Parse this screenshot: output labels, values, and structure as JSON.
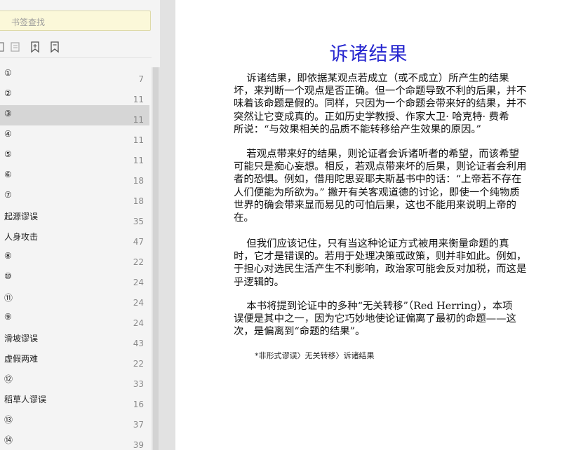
{
  "search": {
    "placeholder": "书签查找"
  },
  "toolbar": {
    "icons": [
      "bookmark-outline-icon",
      "expand-all-icon",
      "add-bookmark-icon",
      "bookmark-icon"
    ]
  },
  "bookmarks": [
    {
      "label": "①",
      "page": "7",
      "selected": false
    },
    {
      "label": "②",
      "page": "11",
      "selected": false
    },
    {
      "label": "③",
      "page": "11",
      "selected": true
    },
    {
      "label": "④",
      "page": "11",
      "selected": false
    },
    {
      "label": "⑤",
      "page": "11",
      "selected": false
    },
    {
      "label": "⑥",
      "page": "18",
      "selected": false
    },
    {
      "label": "⑦",
      "page": "18",
      "selected": false
    },
    {
      "label": "起源谬误",
      "page": "35",
      "selected": false
    },
    {
      "label": "人身攻击",
      "page": "47",
      "selected": false
    },
    {
      "label": "⑧",
      "page": "22",
      "selected": false
    },
    {
      "label": "⑩",
      "page": "24",
      "selected": false
    },
    {
      "label": "⑪",
      "page": "24",
      "selected": false
    },
    {
      "label": "⑨",
      "page": "24",
      "selected": false
    },
    {
      "label": "滑坡谬误",
      "page": "43",
      "selected": false
    },
    {
      "label": "虚假两难",
      "page": "22",
      "selected": false
    },
    {
      "label": "⑫",
      "page": "33",
      "selected": false
    },
    {
      "label": "稻草人谬误",
      "page": "16",
      "selected": false
    },
    {
      "label": "⑬",
      "page": "37",
      "selected": false
    },
    {
      "label": "⑭",
      "page": "39",
      "selected": false
    }
  ],
  "document": {
    "title": "诉诸结果",
    "paragraphs": [
      "    诉诸结果，即依据某观点若成立（或不成立）所产生的结果\n坏，来判断一个观点是否正确。但一个命题导致不利的后果，并不\n味着该命题是假的。同样，只因为一个命题会带来好的结果，并不\n突然让它变成真的。正如历史学教授、作家大卫· 哈克特· 费希\n所说：“与效果相关的品质不能转移给产生效果的原因。”",
      "    若观点带来好的结果，则论证者会诉诸听者的希望，而该希望\n可能只是痴心妄想。相反，若观点带来坏的后果，则论证者会利用\n者的恐惧。例如，借用陀思妥耶夫斯基书中的话：“上帝若不存在\n人们便能为所欲为。” 撇开有关客观道德的讨论，即使一个纯物质\n世界的确会带来显而易见的可怕后果，这也不能用来说明上帝的\n在。",
      "    但我们应该记住，只有当这种论证方式被用来衡量命题的真\n时，它才是错误的。若用于处理决策或政策，则并非如此。例如，\n于担心对选民生活产生不利影响，政治家可能会反对加税，而这是\n乎逻辑的。",
      "    本书将提到论证中的多种“无关转移”（Red Herring），本项\n误便是其中之一，因为它巧妙地使论证偏离了最初的命题——这\n次，是偏离到“命题的结果”。"
    ],
    "breadcrumb": "*非形式谬误〉无关转移〉诉诸结果"
  },
  "colors": {
    "title": "#2727cf",
    "search_bg": "#fbf8d9",
    "selected_row": "#d6d6d6"
  }
}
